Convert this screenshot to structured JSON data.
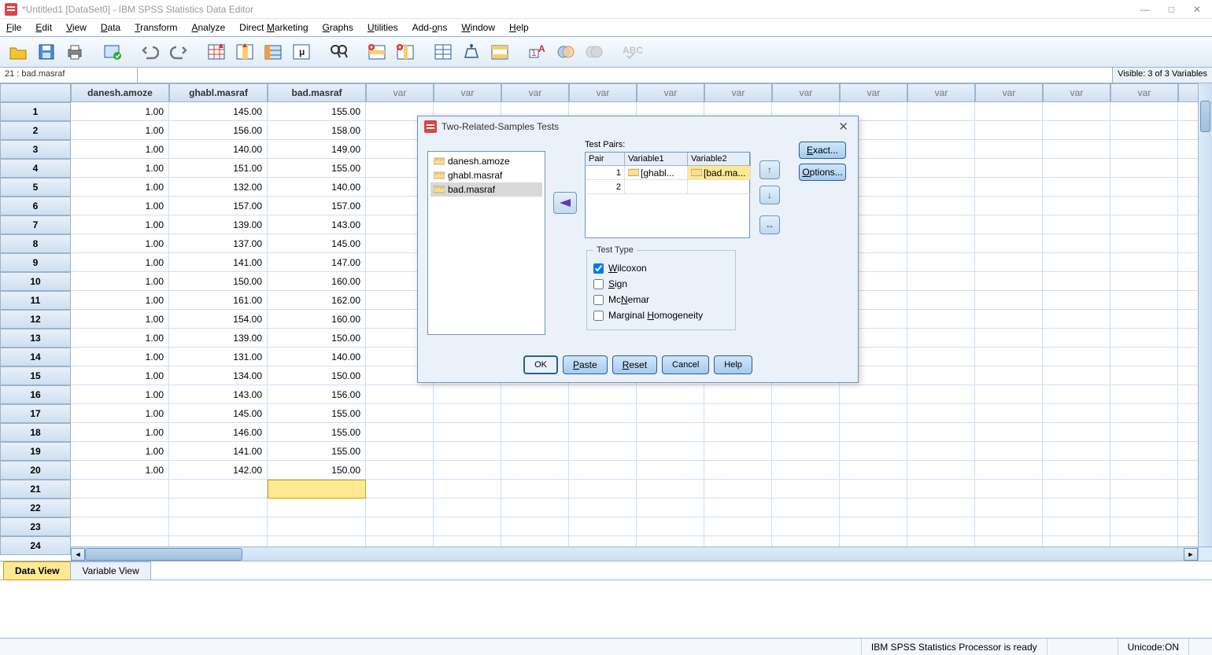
{
  "title": "*Untitled1 [DataSet0] - IBM SPSS Statistics Data Editor",
  "cell_ref": "21 : bad.masraf",
  "visible_label": "Visible: 3 of 3 Variables",
  "menu": {
    "file": "File",
    "edit": "Edit",
    "view": "View",
    "data": "Data",
    "transform": "Transform",
    "analyze": "Analyze",
    "marketing": "Direct Marketing",
    "graphs": "Graphs",
    "utilities": "Utilities",
    "addons": "Add-ons",
    "window": "Window",
    "help": "Help"
  },
  "columns": [
    "danesh.amoze",
    "ghabl.masraf",
    "bad.masraf"
  ],
  "var_label": "var",
  "rows": [
    [
      "1.00",
      "145.00",
      "155.00"
    ],
    [
      "1.00",
      "156.00",
      "158.00"
    ],
    [
      "1.00",
      "140.00",
      "149.00"
    ],
    [
      "1.00",
      "151.00",
      "155.00"
    ],
    [
      "1.00",
      "132.00",
      "140.00"
    ],
    [
      "1.00",
      "157.00",
      "157.00"
    ],
    [
      "1.00",
      "139.00",
      "143.00"
    ],
    [
      "1.00",
      "137.00",
      "145.00"
    ],
    [
      "1.00",
      "141.00",
      "147.00"
    ],
    [
      "1.00",
      "150.00",
      "160.00"
    ],
    [
      "1.00",
      "161.00",
      "162.00"
    ],
    [
      "1.00",
      "154.00",
      "160.00"
    ],
    [
      "1.00",
      "139.00",
      "150.00"
    ],
    [
      "1.00",
      "131.00",
      "140.00"
    ],
    [
      "1.00",
      "134.00",
      "150.00"
    ],
    [
      "1.00",
      "143.00",
      "156.00"
    ],
    [
      "1.00",
      "145.00",
      "155.00"
    ],
    [
      "1.00",
      "146.00",
      "155.00"
    ],
    [
      "1.00",
      "141.00",
      "155.00"
    ],
    [
      "1.00",
      "142.00",
      "150.00"
    ]
  ],
  "sheet_tabs": {
    "data": "Data View",
    "variable": "Variable View"
  },
  "status": {
    "processor": "IBM SPSS Statistics Processor is ready",
    "unicode": "Unicode:ON"
  },
  "dialog": {
    "title": "Two-Related-Samples Tests",
    "vars": [
      "danesh.amoze",
      "ghabl.masraf",
      "bad.masraf"
    ],
    "pairs_label": "Test Pairs:",
    "pair_headers": [
      "Pair",
      "Variable1",
      "Variable2"
    ],
    "pair_rows": [
      [
        "1",
        "[ghabl...",
        "[bad.ma..."
      ],
      [
        "2",
        "",
        ""
      ]
    ],
    "exact": "Exact...",
    "options": "Options...",
    "test_type_label": "Test Type",
    "tests": {
      "wilcoxon": "Wilcoxon",
      "sign": "Sign",
      "mcnemar": "McNemar",
      "mh": "Marginal Homogeneity"
    },
    "foot": {
      "ok": "OK",
      "paste": "Paste",
      "reset": "Reset",
      "cancel": "Cancel",
      "help": "Help"
    }
  }
}
